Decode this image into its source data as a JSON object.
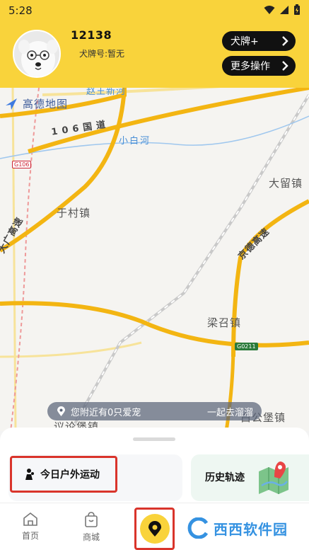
{
  "status_bar": {
    "time": "5:28"
  },
  "profile": {
    "username": "12138",
    "tag_label": "犬牌号:暂无",
    "btn_primary": "犬牌+",
    "btn_more": "更多操作"
  },
  "map": {
    "brand": "高德地图",
    "labels": {
      "road_north": "赵王新河",
      "road_106": "106国道",
      "river": "小白河",
      "town_dali": "大留镇",
      "town_yucun": "于村镇",
      "highway_daguang": "大广高速",
      "highway_jingde": "京德高速",
      "town_liangzhao": "梁召镇",
      "town_yilun": "议论堡镇",
      "town_baigong": "白公堡镇"
    },
    "shields": {
      "g106": "G106",
      "g0211": "G0211"
    },
    "nearby_text": "您附近有0只爱宠",
    "nearby_action": "一起去溜溜"
  },
  "sheet": {
    "today_label": "今日户外运动",
    "history_label": "历史轨迹"
  },
  "tabs": {
    "home": "首页",
    "shop": "商城"
  },
  "watermark": {
    "text": "西西软件园"
  },
  "colors": {
    "brand_yellow": "#f9d33b",
    "highlight_red": "#d9342b",
    "road_yellow": "#f3b512"
  }
}
